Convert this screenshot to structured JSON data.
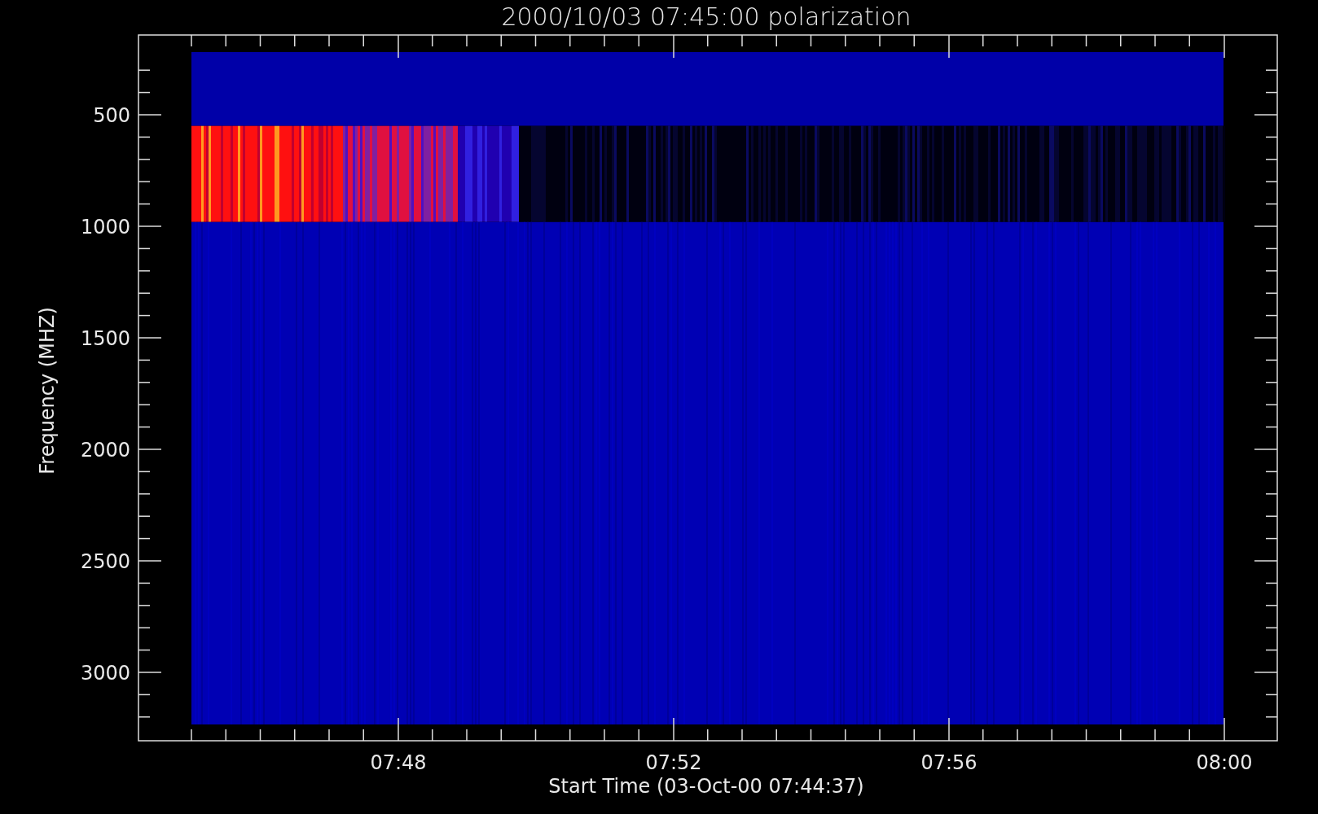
{
  "title": "2000/10/03 07:45:00 polarization",
  "plot": {
    "xlabel": "Start Time (03-Oct-00 07:44:37)",
    "ylabel": "Frequency (MHZ)",
    "xticks": [
      "07:48",
      "07:52",
      "07:56",
      "08:00"
    ],
    "yticks": [
      "500",
      "1000",
      "1500",
      "2000",
      "2500",
      "3000"
    ]
  }
}
